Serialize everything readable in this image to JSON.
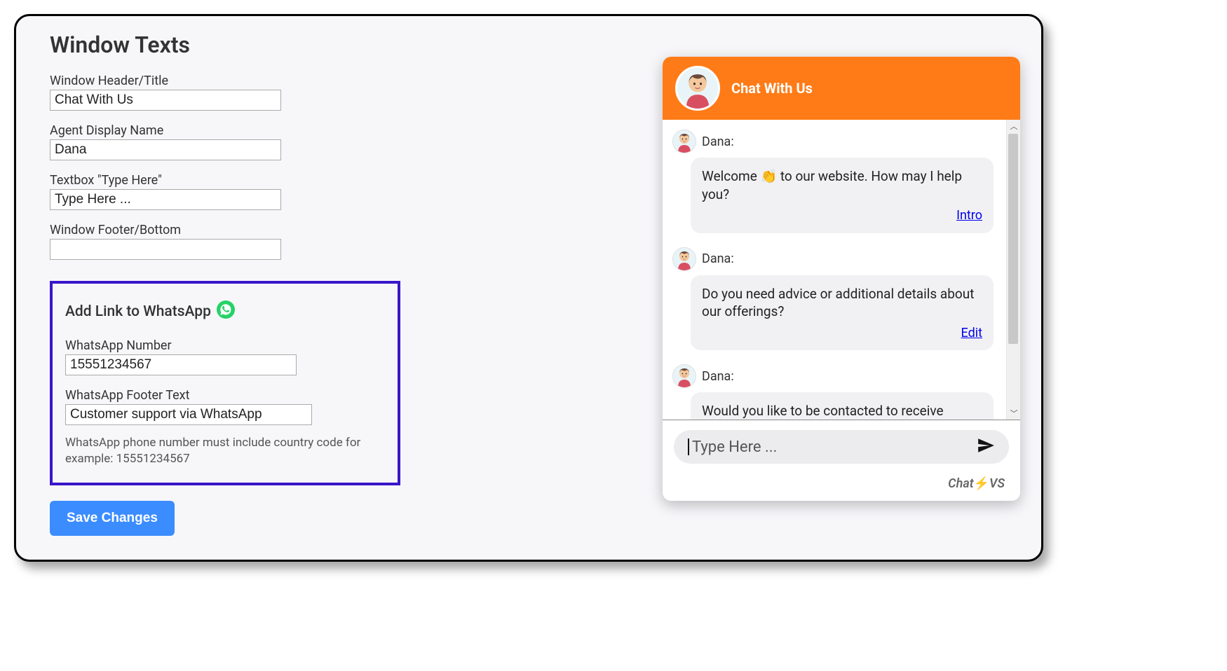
{
  "page": {
    "heading": "Window Texts"
  },
  "fields": {
    "header_label": "Window Header/Title",
    "header_value": "Chat With Us",
    "agent_label": "Agent Display Name",
    "agent_value": "Dana",
    "placeholder_label": "Textbox \"Type Here\"",
    "placeholder_value": "Type Here ...",
    "footer_label": "Window Footer/Bottom",
    "footer_value": ""
  },
  "whatsapp": {
    "heading": "Add Link to WhatsApp",
    "number_label": "WhatsApp Number",
    "number_value": "15551234567",
    "footer_text_label": "WhatsApp Footer Text",
    "footer_text_value": "Customer support via WhatsApp",
    "helper": "WhatsApp phone number must include country code for example: 15551234567"
  },
  "actions": {
    "save_label": "Save Changes"
  },
  "chat": {
    "header_title": "Chat With Us",
    "agent_name": "Dana:",
    "messages": [
      {
        "text": "Welcome 👏 to our website. How may I help you?",
        "link": "Intro"
      },
      {
        "text": "Do you need advice or additional details about our offerings?",
        "link": "Edit"
      },
      {
        "text": "Would you like to be contacted to receive",
        "link": ""
      }
    ],
    "input_placeholder": "Type Here ...",
    "footer_brand": "Chat",
    "footer_suffix": "VS"
  }
}
